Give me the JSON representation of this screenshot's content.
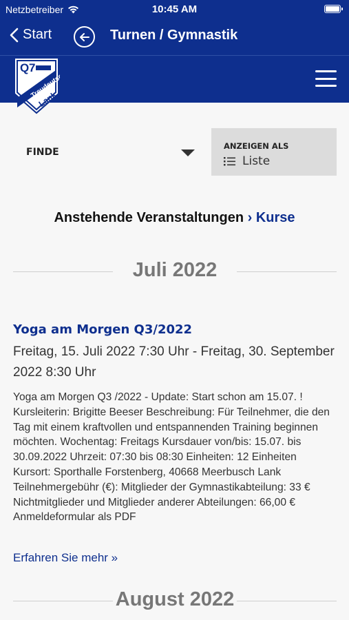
{
  "status_bar": {
    "carrier": "Netzbetreiber",
    "time": "10:45 AM",
    "wifi_icon": "wifi-icon",
    "battery_icon": "battery-icon"
  },
  "nav_bar": {
    "back_label": "Start",
    "title": "Turnen / Gymnastik"
  },
  "header": {
    "logo_alt": "Logo",
    "menu_icon": "hamburger-menu-icon"
  },
  "filter": {
    "label": "FINDE"
  },
  "view_as": {
    "label": "ANZEIGEN ALS",
    "value": "Liste"
  },
  "section": {
    "title": "Anstehende Veranstaltungen",
    "link": "› Kurse"
  },
  "months": [
    "Juli 2022",
    "August 2022"
  ],
  "event": {
    "title": "Yoga am Morgen Q3/2022",
    "date": "Freitag, 15. Juli 2022 7:30 Uhr - Freitag, 30. September 2022 8:30 Uhr",
    "description": "Yoga am Morgen Q3 /2022 - Update: Start schon am 15.07. ! Kursleiterin: Brigitte Beeser Beschreibung: Für Teilnehmer, die den Tag mit einem kraftvollen und entspannenden Training beginnen möchten. Wochentag: Freitags Kursdauer von/bis: 15.07. bis 30.09.2022 Uhrzeit: 07:30 bis 08:30 Einheiten: 12 Einheiten Kursort: Sporthalle Forstenberg, 40668 Meerbusch Lank Teilnehmergebühr (€): Mitglieder der Gymnastikabteilung: 33 € Nichtmitglieder und Mitglieder anderer Abteilungen: 66,00 € Anmeldeformular als PDF",
    "more_label": "Erfahren Sie mehr »"
  },
  "colors": {
    "brand": "#0e2f8e",
    "muted_heading": "#777777"
  }
}
